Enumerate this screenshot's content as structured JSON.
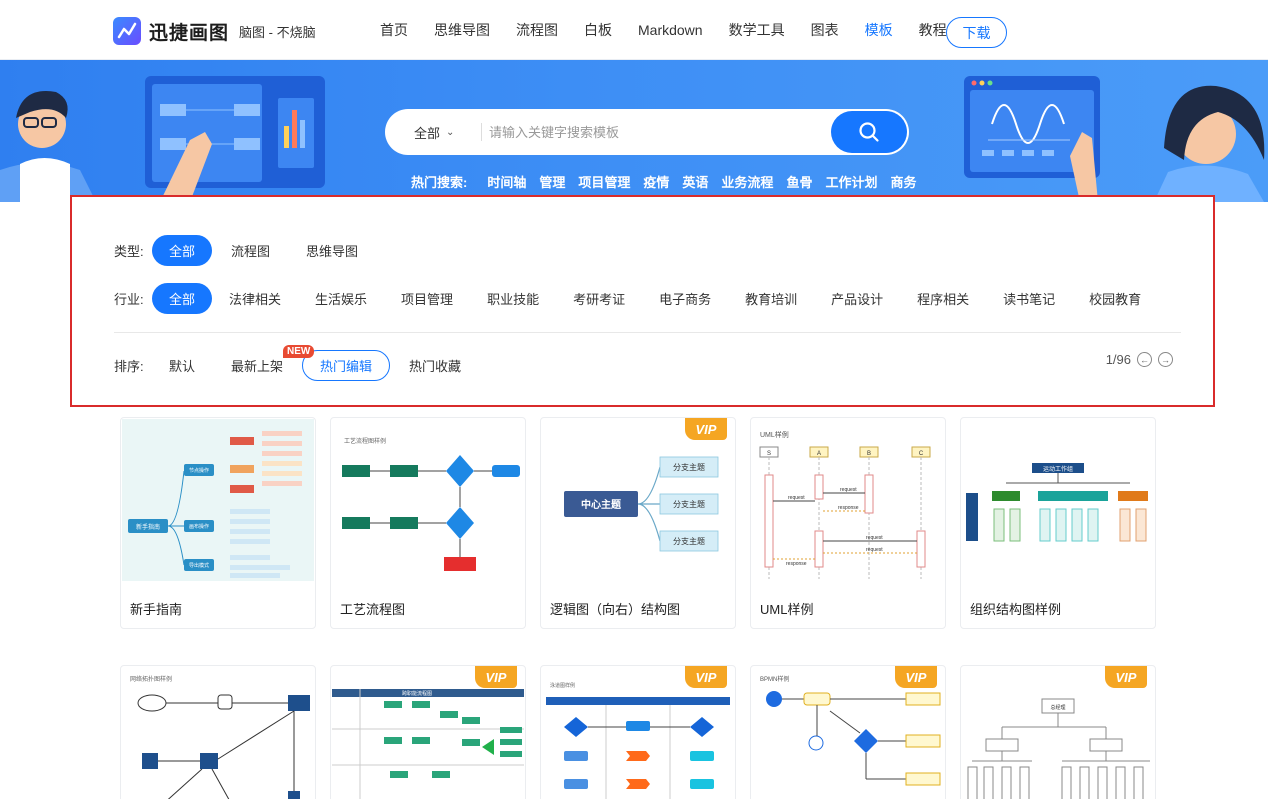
{
  "header": {
    "logo_name": "迅捷画图",
    "logo_subtitle": "脑图 - 不烧脑",
    "nav": [
      {
        "label": "首页",
        "active": false
      },
      {
        "label": "思维导图",
        "active": false
      },
      {
        "label": "流程图",
        "active": false
      },
      {
        "label": "白板",
        "active": false
      },
      {
        "label": "Markdown",
        "active": false
      },
      {
        "label": "数学工具",
        "active": false
      },
      {
        "label": "图表",
        "active": false
      },
      {
        "label": "模板",
        "active": true
      },
      {
        "label": "教程",
        "active": false
      }
    ],
    "download_label": "下载"
  },
  "search": {
    "scope": "全部",
    "placeholder": "请输入关键字搜索模板",
    "hot_label": "热门搜索:",
    "hot_terms": [
      "时间轴",
      "管理",
      "项目管理",
      "疫情",
      "英语",
      "业务流程",
      "鱼骨",
      "工作计划",
      "商务"
    ]
  },
  "filters": {
    "type_label": "类型:",
    "types": [
      {
        "label": "全部",
        "selected": true
      },
      {
        "label": "流程图",
        "selected": false
      },
      {
        "label": "思维导图",
        "selected": false
      }
    ],
    "industry_label": "行业:",
    "industries": [
      {
        "label": "全部",
        "selected": true
      },
      {
        "label": "法律相关",
        "selected": false
      },
      {
        "label": "生活娱乐",
        "selected": false
      },
      {
        "label": "项目管理",
        "selected": false
      },
      {
        "label": "职业技能",
        "selected": false
      },
      {
        "label": "考研考证",
        "selected": false
      },
      {
        "label": "电子商务",
        "selected": false
      },
      {
        "label": "教育培训",
        "selected": false
      },
      {
        "label": "产品设计",
        "selected": false
      },
      {
        "label": "程序相关",
        "selected": false
      },
      {
        "label": "读书笔记",
        "selected": false
      },
      {
        "label": "校园教育",
        "selected": false
      }
    ],
    "sort_label": "排序:",
    "sorts": [
      {
        "label": "默认",
        "selected": false
      },
      {
        "label": "最新上架",
        "selected": false
      },
      {
        "label": "热门编辑",
        "selected": true
      },
      {
        "label": "热门收藏",
        "selected": false
      }
    ],
    "new_badge": "NEW",
    "pager": "1/96"
  },
  "templates_row1": [
    {
      "title": "新手指南",
      "vip": false,
      "thumb": {
        "root": "新手指南",
        "branches": [
          "节点操作",
          "画布操作",
          "导出模式"
        ]
      }
    },
    {
      "title": "工艺流程图",
      "vip": false,
      "thumb": {
        "heading": "工艺流程图样例"
      }
    },
    {
      "title": "逻辑图（向右）结构图",
      "vip": true,
      "thumb": {
        "center": "中心主题",
        "branches": [
          "分支主题",
          "分支主题",
          "分支主题"
        ]
      }
    },
    {
      "title": "UML样例",
      "vip": false,
      "thumb": {
        "heading": "UML样例",
        "lanes": [
          "S",
          "A",
          "B",
          "C"
        ],
        "messages": [
          "request",
          "request",
          "response",
          "request",
          "request",
          "response"
        ]
      }
    },
    {
      "title": "组织结构图样例",
      "vip": false,
      "thumb": {
        "top": "运动工作组"
      }
    }
  ],
  "templates_row2": [
    {
      "vip": false,
      "thumb": {
        "heading": "网络拓扑图样例"
      }
    },
    {
      "vip": true,
      "thumb": {
        "heading": "跨职能流程图"
      }
    },
    {
      "vip": true,
      "thumb": {
        "heading": "泳道图样例"
      }
    },
    {
      "vip": true,
      "thumb": {
        "heading": "BPMN样例"
      }
    },
    {
      "vip": true,
      "thumb": {
        "top": "总经理"
      }
    }
  ],
  "vip_label": "VIP",
  "colors": {
    "primary": "#1677ff",
    "banner": "#3d8ef5",
    "vip": "#f5a623",
    "highlight_border": "#d92b2b"
  }
}
